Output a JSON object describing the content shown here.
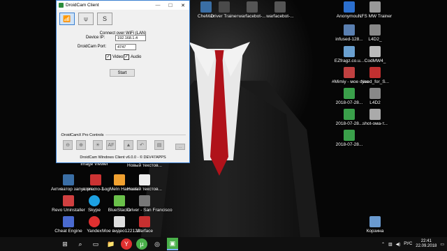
{
  "window": {
    "title": "DroidCam Client",
    "minimize": "—",
    "maximize": "☐",
    "close": "✕",
    "tabs": [
      {
        "icon": "wifi-icon",
        "glyph": "📶"
      },
      {
        "icon": "usb-icon",
        "glyph": "⍦"
      },
      {
        "icon": "wifi-s-icon",
        "glyph": "S"
      }
    ],
    "connect_header": "Connect over WiFi (LAN)",
    "device_ip_label": "Device IP:",
    "device_ip_value": "192.168.1.4",
    "port_label": "DroidCam Port:",
    "port_value": "4747",
    "video_label": "Video",
    "audio_label": "Audio",
    "start_label": "Start",
    "pro_controls_label": "DroidCamX Pro Controls",
    "footer": "DroidCam Windows Client v6.0.0 - © DEV47APPS",
    "tools": [
      "⊖",
      "⊕",
      "☀",
      "AF",
      "▲",
      "↶",
      "▤",
      "…"
    ]
  },
  "desktop_icons": [
    {
      "label": "CheMax",
      "color": "#3a6ea5"
    },
    {
      "label": "Driver Trainer",
      "color": "#4a4a4a"
    },
    {
      "label": "warfacebot-...",
      "color": "#555"
    },
    {
      "label": "warfacebot-...",
      "color": "#555"
    },
    {
      "label": "Anonymou...",
      "color": "#2b6fcf"
    },
    {
      "label": "NFS MW Trainer",
      "color": "#999"
    },
    {
      "label": "infused-128...",
      "color": "#5a7fb0"
    },
    {
      "label": "L4D2_",
      "color": "#888"
    },
    {
      "label": "EZfragz.co.u...",
      "color": "#6aa0d0"
    },
    {
      "label": "CodMW4_",
      "color": "#bbb"
    },
    {
      "label": "#Mimiy - мое сука",
      "color": "#c04040"
    },
    {
      "label": "Need_for_S...",
      "color": "#c03030"
    },
    {
      "label": "2018-07-28...",
      "color": "#3aa04a"
    },
    {
      "label": "L4D2",
      "color": "#888"
    },
    {
      "label": "2018-07-28...",
      "color": "#3aa04a"
    },
    {
      "label": "shot-ома-т...",
      "color": "#aaa"
    },
    {
      "label": "2018-07-28...",
      "color": "#3aa04a"
    },
    {
      "label": "Image Viewer",
      "color": "#3a6ea5"
    },
    {
      "label": "Новый текстов...",
      "color": "#eee"
    },
    {
      "label": "Активатор запустит...",
      "color": "#3a6ea5"
    },
    {
      "label": "supremo-3-...",
      "color": "#cc3333"
    },
    {
      "label": "LogMeIn Hamachi",
      "color": "#f0a030"
    },
    {
      "label": "Новый текстов...",
      "color": "#eee"
    },
    {
      "label": "Revo Uninstaller",
      "color": "#d04040"
    },
    {
      "label": "Skype",
      "color": "#1da1e2"
    },
    {
      "label": "BlueStacks",
      "color": "#6ac04a"
    },
    {
      "label": "Driver - San Francisco",
      "color": "#777"
    },
    {
      "label": "Cheat Engine",
      "color": "#4a6ad0"
    },
    {
      "label": "Yandex",
      "color": "#e03030"
    },
    {
      "label": "Мое видео122122",
      "color": "#ddd"
    },
    {
      "label": "Warface",
      "color": "#c83030"
    },
    {
      "label": "Корзина",
      "color": "#6a9ad0"
    }
  ],
  "taskbar": {
    "start_glyph": "⊞",
    "search_glyph": "⌕",
    "taskview_glyph": "▭",
    "items": [
      {
        "icon": "explorer-icon",
        "glyph": "📁",
        "color": "#e8c04a"
      },
      {
        "icon": "yandex-browser-icon",
        "glyph": "Y",
        "color": "#e03030"
      },
      {
        "icon": "utorrent-icon",
        "glyph": "µ",
        "color": "#4ab04a"
      },
      {
        "icon": "steam-icon",
        "glyph": "◎",
        "color": "#999"
      },
      {
        "icon": "droidcam-icon",
        "glyph": "▣",
        "color": "#4ab04a"
      }
    ],
    "language": "РУС",
    "time": "22:41",
    "date": "22.09.2018"
  }
}
